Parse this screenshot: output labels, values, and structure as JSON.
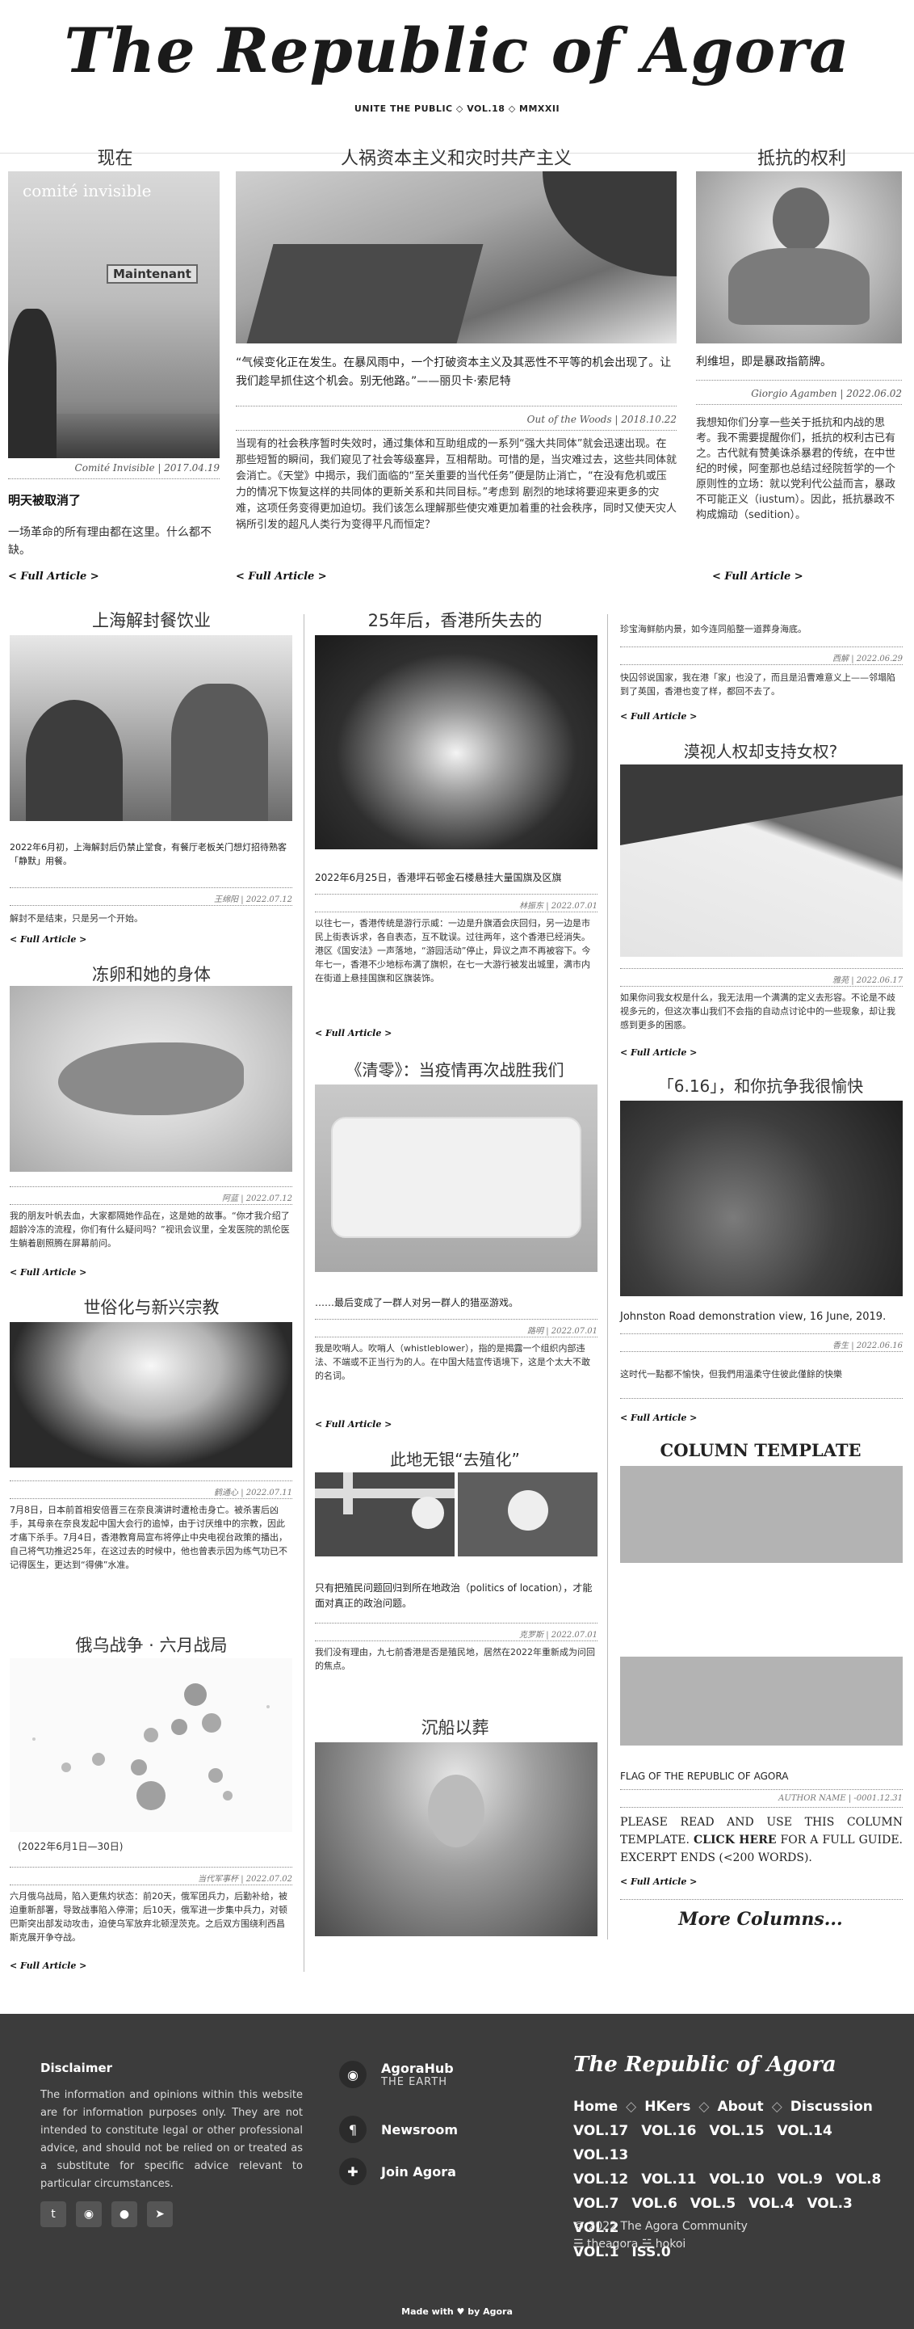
{
  "masthead": {
    "title": "The Republic of Agora",
    "subline": "UNITE THE PUBLIC ◇ VOL.18 ◇ MMXXII"
  },
  "top": {
    "left": {
      "section": "现在",
      "img_overlay_top": "comité invisible",
      "img_overlay_label": "Maintenant",
      "meta": "Comité Invisible | 2017.04.19",
      "headline": "明天被取消了",
      "body": "一场革命的所有理由都在这里。什么都不缺。",
      "more": "< Full Article >"
    },
    "center": {
      "section": "人祸资本主义和灾时共产主义",
      "quote": "“气候变化正在发生。在暴风雨中，一个打破资本主义及其恶性不平等的机会出现了。让我们趁早抓住这个机会。别无他路。”——丽贝卡·索尼特",
      "meta": "Out of the Woods | 2018.10.22",
      "body": "当现有的社会秩序暂时失效时，通过集体和互助组成的一系列“强大共同体”就会迅速出现。在那些短暂的瞬间，我们窥见了社会等级塞异，互相帮助。可惜的是，当灾难过去，这些共同体就会消亡。《天堂》中揭示，我们面临的“至关重要的当代任务”便是防止消亡，“在没有危机或压力的情况下恢复这样的共同体的更新关系和共同目标。”考虑到 剧烈的地球将要迎来更多的灾难，这项任务变得更加迫切。我们该怎么理解那些使灾难更加着重的社会秩序，同时又使天灾人祸所引发的超凡人类行为变得平凡而恒定？",
      "more": "< Full Article >"
    },
    "right": {
      "section": "抵抗的权利",
      "quote": "利维坦，即是暴政指箭牌。",
      "meta": "Giorgio Agamben | 2022.06.02",
      "body": "我想知你们分享一些关于抵抗和内战的思考。我不需要提醒你们，抵抗的权利古已有之。古代就有赞美诛杀暴君的传统，在中世纪的时候，阿奎那也总结过经院哲学的一个原则性的立场：就以党利代公益而言，暴政不可能正义（iustum）。因此，抵抗暴政不构成煽动（sedition）。",
      "more": "< Full Article >"
    }
  },
  "col1": [
    {
      "section": "上海解封餐饮业",
      "cap": "2022年6月初，上海解封后仍禁止堂食，有餐厅老板关门想灯招待熟客「静默」用餐。",
      "meta": "王绵阳 | 2022.07.12",
      "body": "解封不是结束，只是另一个开始。",
      "more": "< Full Article >"
    },
    {
      "section": "冻卵和她的身体",
      "meta": "阿蓝 | 2022.07.12",
      "body": "我的朋友叶帆去血，大家都隔她作品在，这是她的故事。“你才我介绍了超龄冷冻的流程，你们有什么疑问吗？”视讯会议里，全发医院的凯伦医生躺着剧照腾在屏幕前问。",
      "more": "< Full Article >"
    },
    {
      "section": "世俗化与新兴宗教",
      "meta": "鹤通心 | 2022.07.11",
      "body": "7月8日，日本前首相安倍晋三在奈良演讲时遭枪击身亡。被杀害后凶手，其母亲在奈良发起中国大会行的追悼，由于讨厌维中的宗教，因此才痛下杀手。7月4日，香港教育局宣布将停止中央电视台政策的播出，自己将气功推迟25年，在这过去的时候中，他也曾表示因为练气功已不记得医生，更达到“得佛”水准。",
      "more": ""
    },
    {
      "section": "俄乌战争 · 六月战局",
      "img_caption": "(2022年6月1日—30日)",
      "meta": "当代军事杯 | 2022.07.02",
      "body": "六月俄乌战局，陷入更焦灼状态：前20天，俄军团兵力，后勤补给，被迫重新部署，导致战事陷入停滞；后10天，俄军进一步集中兵力，对顿巴斯突出部发动攻击，迫使乌军放弃北顿涅茨克。之后双方围绕利西昌斯克展开争夺战。",
      "more": "< Full Article >"
    }
  ],
  "col2": [
    {
      "section": "25年后，香港所失去的",
      "cap": "2022年6月25日，香港坪石邨金石楼悬挂大量国旗及区旗",
      "meta": "林振东 | 2022.07.01",
      "body": "以往七一，香港传统是游行示威：一边是升旗酒会庆回归，另一边是市民上街表诉求，各自表态，互不耽误。过往两年，这个香港已经消失。港区《国安法》一声落地，“游园活动”停止，异议之声不再被容下。今年七一，香港不少地标布满了旗帜，在七一大游行被发出城里，满市内在街道上悬挂国旗和区旗装饰。",
      "more": "< Full Article >"
    },
    {
      "section": "《清零》：当疫情再次战胜我们",
      "cap": "……最后变成了一群人对另一群人的猎巫游戏。",
      "meta": "路明 | 2022.07.01",
      "body": "我是吹哨人。吹哨人（whistleblower），指的是揭露一个组织内部违法、不端或不正当行为的人。在中国大陆宣传语境下，这是个太大不敢的名词。",
      "more": "< Full Article >"
    },
    {
      "section": "此地无银“去殖化”",
      "cap": "只有把殖民问题回归到所在地政治（politics of location），才能面对真正的政治问题。",
      "meta": "克罗斯 | 2022.07.01",
      "body": "我们没有理由，九七前香港是否是殖民地，居然在2022年重新成为问回的焦点。",
      "more": ""
    },
    {
      "section": "沉船以葬",
      "more": ""
    }
  ],
  "col3": {
    "top_body": "珍宝海鲜舫内景，如今连同船整一道葬身海底。",
    "top_meta": "西解 | 2022.06.29",
    "top_body2": "快囚邻说国家，我在港「家」也没了，而且是沿曹难意义上——邻塌陷到了英国，香港也变了样，都回不去了。",
    "top_more": "< Full Article >",
    "penguin": {
      "section": "漠视人权却支持女权?",
      "meta": "雅苑 | 2022.06.17",
      "body": "如果你问我女权是什么，我无法用一个满满的定义去形容。不论是不歧视多元的，但这次事山我们不会指的自动点讨论中的一些现象，却让我感到更多的困惑。",
      "more": "< Full Article >"
    },
    "june": {
      "section": "「6.16」，和你抗争我很愉快",
      "cap": "Johnston Road demonstration view, 16 June, 2019.",
      "meta": "香生 | 2022.06.16",
      "body": "这时代一點都不愉快，但我們用溫柔守住彼此僅餘的快樂",
      "more": "< Full Article >"
    },
    "template": {
      "section": "COLUMN TEMPLATE",
      "cap": "FLAG OF THE REPUBLIC OF AGORA",
      "meta": "AUTHOR NAME | -0001.12.31",
      "body_a": "PLEASE READ AND USE THIS COLUMN TEMPLATE.",
      "body_link": "CLICK HERE",
      "body_b": "FOR A FULL GUIDE. EXCERPT ENDS (<200 WORDS).",
      "more": "< Full Article >"
    },
    "more_columns": "More Columns..."
  },
  "footer": {
    "disclaimer_title": "Disclaimer",
    "disclaimer_text": "The information and opinions within this website are for information purposes only. They are not intended to constitute legal or other professional advice, and should not be relied on or treated as a substitute for specific advice relevant to particular circumstances.",
    "social": [
      "t",
      "◉",
      "●",
      "➤"
    ],
    "nav": [
      {
        "label": "AgoraHub",
        "sub": "THE EARTH",
        "icon": "◉"
      },
      {
        "label": "Newsroom",
        "sub": "",
        "icon": "¶"
      },
      {
        "label": "Join Agora",
        "sub": "",
        "icon": "✚"
      }
    ],
    "brand": "The Republic of Agora",
    "links_row1": [
      "Home",
      "HKers",
      "About",
      "Discussion"
    ],
    "volumes": [
      "VOL.17",
      "VOL.16",
      "VOL.15",
      "VOL.14",
      "VOL.13",
      "VOL.12",
      "VOL.11",
      "VOL.10",
      "VOL.9",
      "VOL.8",
      "VOL.7",
      "VOL.6",
      "VOL.5",
      "VOL.4",
      "VOL.3",
      "VOL.2",
      "VOL.1",
      "ISS.0"
    ],
    "copyright": "© 2022 The Agora Community",
    "credits": "☰ theagora ☱ hokoi",
    "made_with": "Made with ♥ by Agora"
  }
}
